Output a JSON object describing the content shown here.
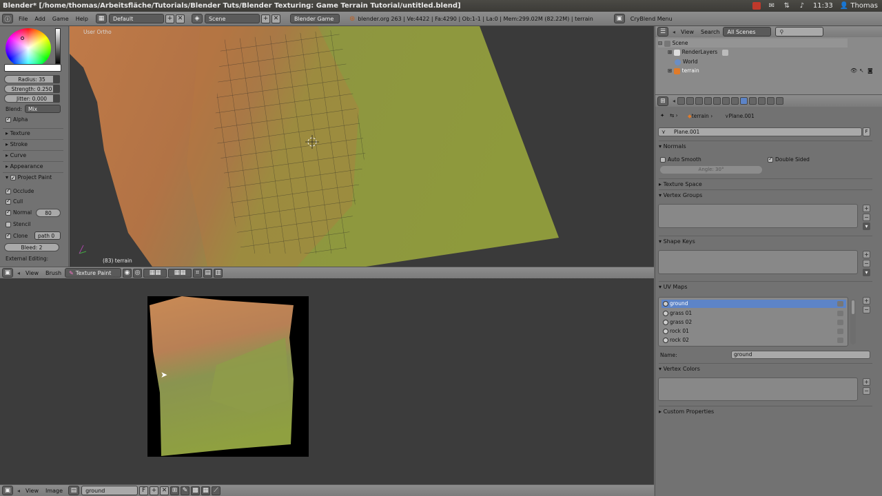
{
  "os": {
    "title": "Blender* [/home/thomas/Arbeitsfläche/Tutorials/Blender Tuts/Blender Texturing: Game Terrain Tutorial/untitled.blend]",
    "time": "11:33",
    "user": "Thomas"
  },
  "info_header": {
    "menu": [
      "File",
      "Add",
      "Game",
      "Help"
    ],
    "layout": "Default",
    "scene": "Scene",
    "engine": "Blender Game",
    "stats": "blender.org 263 | Ve:4422 | Fa:4290 | Ob:1-1 | La:0 | Mem:299.02M (82.22M) | terrain",
    "menu_right": "CryBlend Menu"
  },
  "tool_shelf": {
    "radius": "Radius: 35",
    "strength": "Strength: 0.250",
    "jitter": "Jitter: 0.000",
    "blend_label": "Blend:",
    "blend_value": "Mix",
    "alpha": "Alpha",
    "texture": "Texture",
    "stroke": "Stroke",
    "curve": "Curve",
    "appearance": "Appearance",
    "project_paint": "Project Paint",
    "occlude": "Occlude",
    "cull": "Cull",
    "normal": "Normal",
    "normal_value": "80",
    "stencil": "Stencil",
    "clone": "Clone",
    "clone_value": "path 0",
    "bleed": "Bleed: 2",
    "external": "External Editing:"
  },
  "viewport": {
    "label": "User Ortho",
    "object": "(83) terrain"
  },
  "v3d_header": {
    "view": "View",
    "brush": "Brush",
    "mode": "Texture Paint"
  },
  "img_header": {
    "view": "View",
    "image": "Image",
    "image_name": "ground",
    "fake": "F"
  },
  "outliner": {
    "view": "View",
    "search": "Search",
    "scenes": "All Scenes",
    "items": [
      "Scene",
      "RenderLayers",
      "World",
      "terrain"
    ]
  },
  "properties": {
    "breadcrumb_obj": "terrain",
    "breadcrumb_mesh": "Plane.001",
    "mesh_name": "Plane.001",
    "fake": "F",
    "normals": "Normals",
    "auto_smooth": "Auto Smooth",
    "double_sided": "Double Sided",
    "angle": "Angle: 30°",
    "texture_space": "Texture Space",
    "vertex_groups": "Vertex Groups",
    "shape_keys": "Shape Keys",
    "uv_maps": "UV Maps",
    "uv_list": [
      "ground",
      "grass 01",
      "grass 02",
      "rock 01",
      "rock 02"
    ],
    "name_label": "Name:",
    "name_value": "ground",
    "vertex_colors": "Vertex Colors",
    "custom_props": "Custom Properties"
  },
  "colors": {
    "selection": "#5d84c7",
    "grass": "#8a9a3a",
    "dirt": "#b8753f"
  }
}
